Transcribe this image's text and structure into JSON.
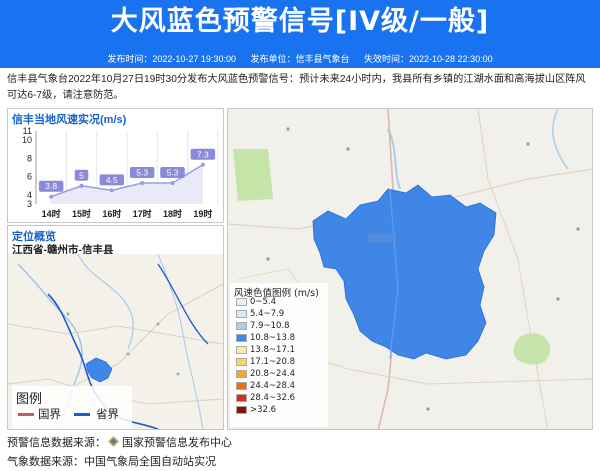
{
  "banner": {
    "title": "大风蓝色预警信号[IV级/一般]",
    "publish_time": "发布时间：2022-10-27 19:30:00",
    "publisher": "发布单位：信丰县气象台",
    "expire_time": "失效时间：2022-10-28 22:30:00"
  },
  "description": "信丰县气象台2022年10月27日19时30分发布大风蓝色预警信号：预计未来24小时内，我县所有乡镇的江湖水面和高海拔山区阵风可达6-7级，请注意防范。",
  "wind_panel": {
    "title": "信丰当地风速实况(m/s)"
  },
  "chart_data": {
    "type": "line",
    "title": "信丰当地风速实况(m/s)",
    "categories": [
      "14时",
      "15时",
      "16时",
      "17时",
      "18时",
      "19时"
    ],
    "values": [
      3.8,
      5,
      4.5,
      5.3,
      5.3,
      7.3
    ],
    "value_labels": [
      "3.8",
      "5",
      "4.5",
      "5.3",
      "5.3",
      "7.3"
    ],
    "yticks": [
      "3",
      "4",
      "6",
      "8",
      "10",
      "11"
    ],
    "ylim": [
      3,
      11
    ],
    "line_color": "#9a9ae6"
  },
  "location_panel": {
    "title": "定位概览",
    "subtitle": "江西省-赣州市-信丰县",
    "legend_title": "图例",
    "legend_items": [
      {
        "label": "国界",
        "color": "#c25a6a"
      },
      {
        "label": "省界",
        "color": "#1b5bd1"
      }
    ]
  },
  "scale": {
    "title": "风速色值图例 (m/s)",
    "items": [
      {
        "label": "0~5.4",
        "color": "#eeeeee"
      },
      {
        "label": "5.4~7.9",
        "color": "#d6e9f8"
      },
      {
        "label": "7.9~10.8",
        "color": "#a9cff2"
      },
      {
        "label": "10.8~13.8",
        "color": "#3f86e6"
      },
      {
        "label": "13.8~17.1",
        "color": "#f6f1a6"
      },
      {
        "label": "17.1~20.8",
        "color": "#f7d95a"
      },
      {
        "label": "20.8~24.4",
        "color": "#f4a72a"
      },
      {
        "label": "24.4~28.4",
        "color": "#ee6a14"
      },
      {
        "label": "28.4~32.6",
        "color": "#d33016"
      },
      {
        "label": ">32.6",
        "color": "#8b0e0e"
      }
    ]
  },
  "footer": {
    "warning_source_label": "预警信息数据来源：",
    "warning_source": "国家预警信息发布中心",
    "weather_source_label": "气象数据来源：",
    "weather_source": "中国气象局全国自动站实况"
  },
  "colors": {
    "brand_blue": "#1973f0",
    "area_blue": "#3f86e6",
    "panel_title": "#1562c9"
  }
}
